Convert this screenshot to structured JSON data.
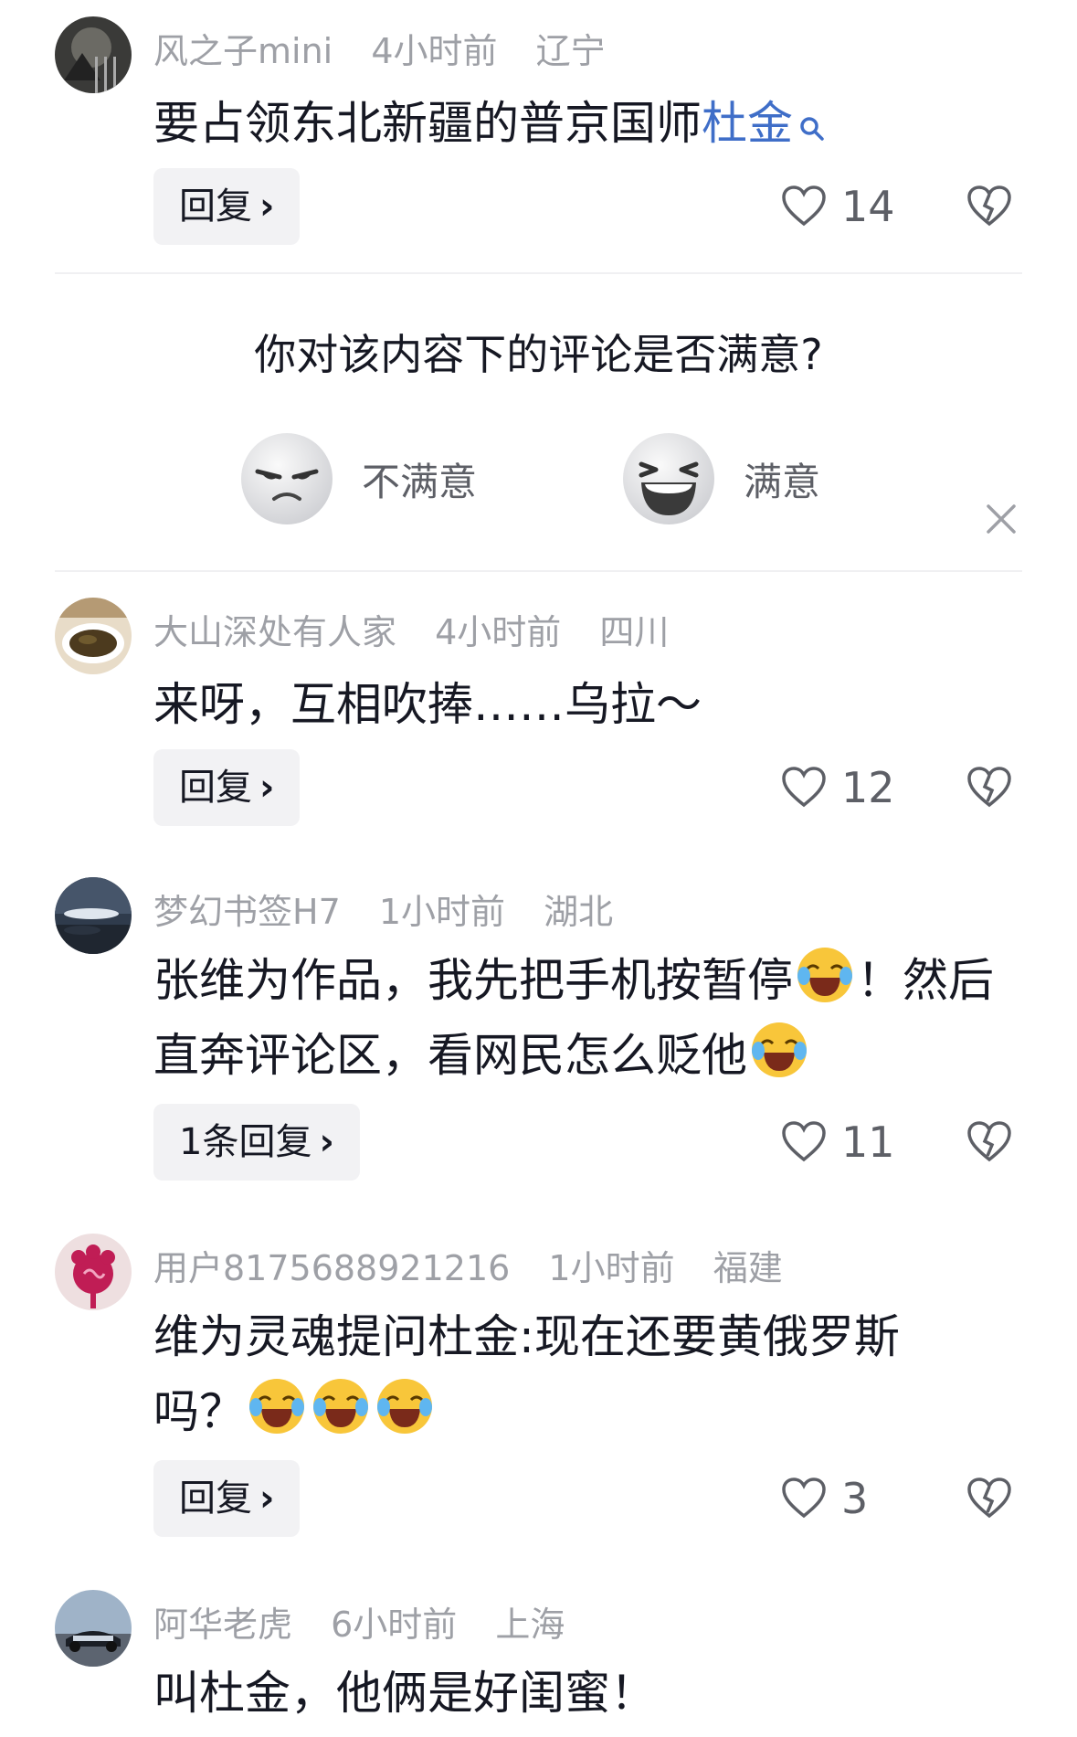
{
  "comments": [
    {
      "username": "风之子mini",
      "time": "4小时前",
      "location": "辽宁",
      "text_before": "要占领东北新疆的普京国师",
      "mention": "杜金",
      "reply_label": "回复",
      "likes": "14"
    },
    {
      "username": "大山深处有人家",
      "time": "4小时前",
      "location": "四川",
      "text": "来呀，互相吹捧……乌拉～",
      "reply_label": "回复",
      "likes": "12"
    },
    {
      "username": "梦幻书签H7",
      "time": "1小时前",
      "location": "湖北",
      "text_1": "张维为作品，我先把手机按暂停",
      "text_2": "！然后直奔评论区，看网民怎么贬他",
      "reply_label": "1条回复",
      "likes": "11"
    },
    {
      "username": "用户8175688921216",
      "time": "1小时前",
      "location": "福建",
      "text": "维为灵魂提问杜金:现在还要黄俄罗斯吗？",
      "reply_label": "回复",
      "likes": "3"
    },
    {
      "username": "阿华老虎",
      "time": "6小时前",
      "location": "上海",
      "text": "叫杜金，他俩是好闺蜜！"
    }
  ],
  "survey": {
    "question": "你对该内容下的评论是否满意?",
    "option_unsatisfied": "不满意",
    "option_satisfied": "满意"
  },
  "icons": {
    "like": "heart-outline-icon",
    "dislike": "broken-heart-icon",
    "reply_chevron": "chevron-right-icon",
    "close": "close-icon",
    "mention_search": "search-icon",
    "emoji": "laughing-crying-emoji"
  },
  "colors": {
    "text": "#161823",
    "meta": "#9ea0a6",
    "mention": "#3f6ec8",
    "button_bg": "#f2f2f4"
  }
}
